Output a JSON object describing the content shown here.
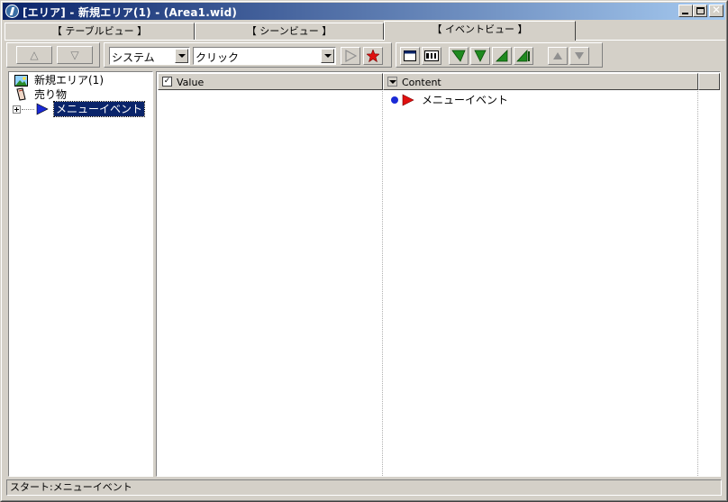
{
  "window": {
    "title": "[エリア] - 新規エリア(1) - (Area1.wid)",
    "caption_buttons": {
      "minimize": "minimize-icon",
      "maximize": "maximize-icon",
      "close": "close-icon",
      "close_glyph": "✕"
    }
  },
  "tabs": [
    {
      "label": "【 テーブルビュー 】"
    },
    {
      "label": "【 シーンビュー 】"
    },
    {
      "label": "【 イベントビュー 】",
      "active": true
    }
  ],
  "toolbar": {
    "up_glyph": "△",
    "down_glyph": "▽",
    "category_select": {
      "value": "システム"
    },
    "action_select": {
      "value": "クリック"
    },
    "icons": [
      "play-outline-icon",
      "delete-star-icon",
      "window-icon",
      "text-field-icon",
      "flag-add-icon",
      "flag-icon",
      "triangle-icon",
      "flag-stack-icon",
      "move-up-icon",
      "move-down-icon"
    ]
  },
  "tree": {
    "items": [
      {
        "label": "新規エリア(1)",
        "icon": "picture-icon"
      },
      {
        "label": "売り物",
        "icon": "item-tag-icon"
      },
      {
        "label": "メニューイベント",
        "icon": "play-triangle-icon",
        "selected": true
      }
    ]
  },
  "table": {
    "columns": [
      {
        "label": "Value",
        "control": "checkbox",
        "check_glyph": "✓"
      },
      {
        "label": "Content",
        "control": "dropdown"
      }
    ],
    "rows": [
      {
        "content": "メニューイベント"
      }
    ]
  },
  "status_bar": {
    "text": "スタート:メニューイベント"
  },
  "colors": {
    "title_gradient_start": "#0a246a",
    "title_gradient_end": "#a6caf0",
    "face": "#d4d0c8",
    "selection": "#0a246a",
    "flag_red": "#e01010",
    "flag_green": "#1f8a1f"
  }
}
